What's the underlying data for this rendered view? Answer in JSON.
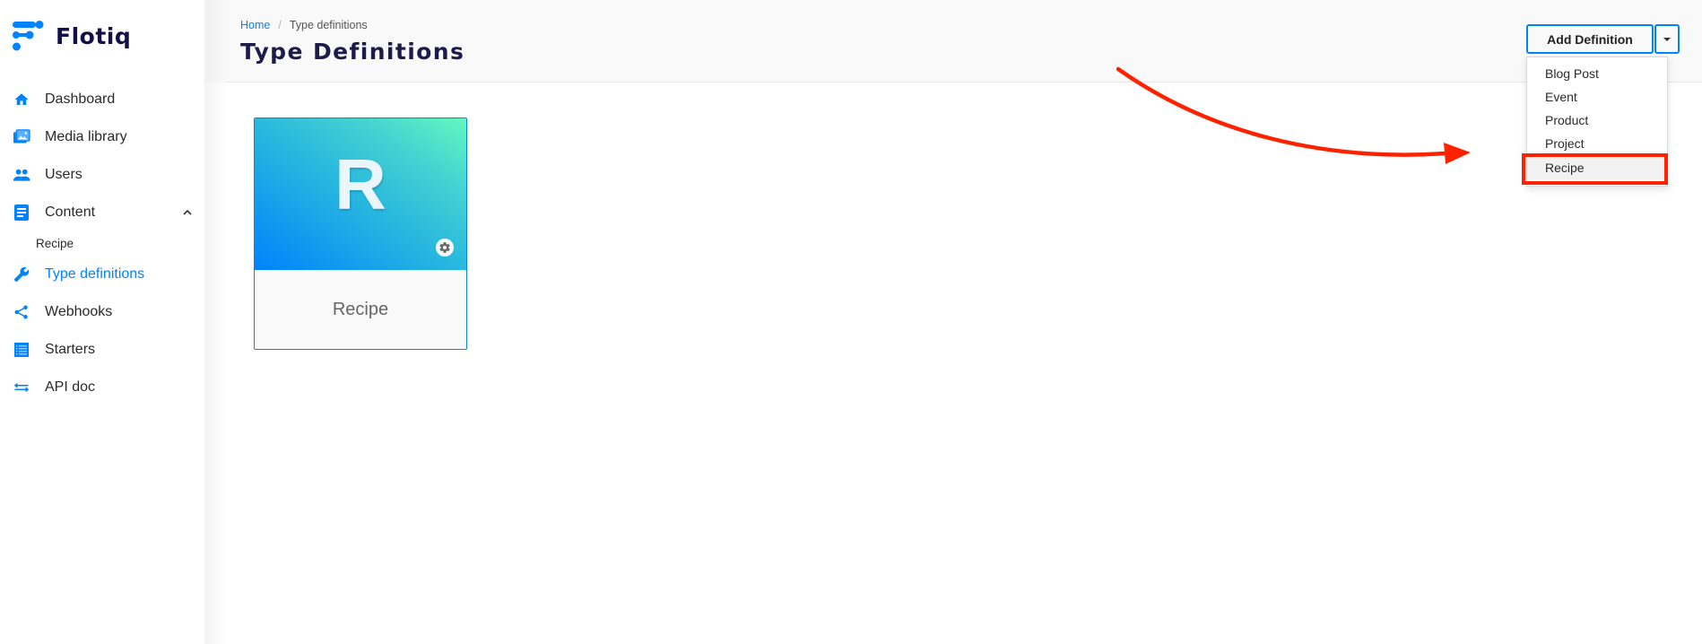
{
  "brand": {
    "name": "Flotiq",
    "accent_color": "#0083fc",
    "logo_icon": "flotiq-logo-icon"
  },
  "sidebar": {
    "items": [
      {
        "label": "Dashboard",
        "icon": "home-icon",
        "active": false
      },
      {
        "label": "Media library",
        "icon": "image-gallery-icon",
        "active": false
      },
      {
        "label": "Users",
        "icon": "users-icon",
        "active": false
      },
      {
        "label": "Content",
        "icon": "document-icon",
        "active": false,
        "expanded": true,
        "children": [
          {
            "label": "Recipe"
          }
        ]
      },
      {
        "label": "Type definitions",
        "icon": "wrench-icon",
        "active": true
      },
      {
        "label": "Webhooks",
        "icon": "share-icon",
        "active": false
      },
      {
        "label": "Starters",
        "icon": "list-icon",
        "active": false
      },
      {
        "label": "API doc",
        "icon": "swap-arrows-icon",
        "active": false
      }
    ]
  },
  "header": {
    "breadcrumb": [
      {
        "label": "Home",
        "link": true
      },
      {
        "label": "Type definitions",
        "link": false
      }
    ],
    "breadcrumb_separator": "/",
    "title": "Type Definitions",
    "add_button_label": "Add Definition",
    "add_caret_icon": "caret-down-icon"
  },
  "dropdown": {
    "items": [
      {
        "label": "Blog Post"
      },
      {
        "label": "Event"
      },
      {
        "label": "Product"
      },
      {
        "label": "Project"
      },
      {
        "label": "Recipe",
        "highlighted": true
      }
    ]
  },
  "cards": [
    {
      "letter": "R",
      "label": "Recipe",
      "settings_icon": "gear-icon"
    }
  ],
  "annotation": {
    "arrow_color": "#ff2200",
    "highlight_color": "#ff2200",
    "target": "Recipe"
  }
}
